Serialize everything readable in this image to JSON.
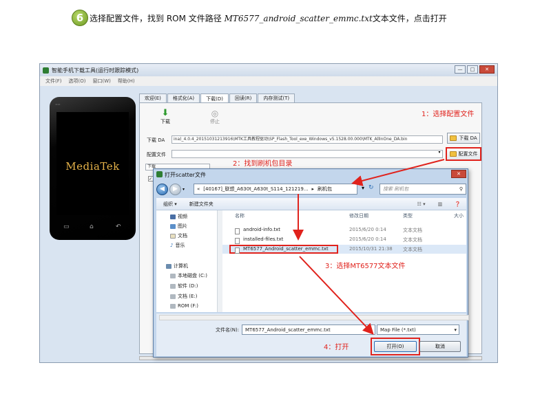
{
  "step": {
    "number": "6",
    "text_prefix": "选择配置文件，找到 ROM 文件路径 ",
    "text_italic": "MT6577_android_scatter_emmc.txt",
    "text_suffix": "文本文件，点击打开"
  },
  "app_window": {
    "title": "智能手机下载工具(运行时跟踪模式)",
    "menu": [
      "文件(F)",
      "选项(O)",
      "窗口(W)",
      "帮助(H)"
    ],
    "phone_brand": "MediaTek",
    "tabs": [
      "欢迎(E)",
      "格式化(A)",
      "下载(D)",
      "回读(R)",
      "内存测试(T)"
    ],
    "active_tab": "下载(D)",
    "download_label": "下载",
    "stop_label": "停止",
    "da_label": "下载 DA",
    "da_path": "ina)_4.0.4_20151031213916\\MTK工具教程驱动\\SP_Flash_Tool_exe_Windows_v5.1528.00.000\\MTK_AllInOne_DA.bin",
    "da_button": "下载 DA",
    "scatter_label": "配置文件",
    "scatter_button": "配置文件",
    "mode_select": "下载"
  },
  "annotations": {
    "a1": "1：选择配置文件",
    "a2": "2：找到刷机包目录",
    "a3": "3：选择MT6577文本文件",
    "a4": "4：打开"
  },
  "dialog": {
    "title": "打开scatter文件",
    "address_parts": [
      "«",
      "[40167]_联想_A630t_A630t_S114_121219...",
      "▸",
      "刷机包"
    ],
    "search_placeholder": "搜索 刷机包",
    "organize": "组织 ▾",
    "new_folder": "新建文件夹",
    "nav_items": [
      "视频",
      "图片",
      "文档",
      "音乐",
      "计算机",
      "本地磁盘 (C:)",
      "软件 (D:)",
      "文档 (E:)",
      "ROM (F:)"
    ],
    "columns": [
      "名称",
      "修改日期",
      "类型",
      "大小"
    ],
    "files": [
      {
        "name": "android-info.txt",
        "date": "2015/6/20 0:14",
        "type": "文本文档"
      },
      {
        "name": "installed-files.txt",
        "date": "2015/6/20 0:14",
        "type": "文本文档"
      },
      {
        "name": "MT6577_Android_scatter_emmc.txt",
        "date": "2015/10/31 21:38",
        "type": "文本文档"
      }
    ],
    "filename_label": "文件名(N):",
    "filename_value": "MT6577_Android_scatter_emmc.txt",
    "filter_value": "Map File (*.txt)",
    "open_button": "打开(O)",
    "cancel_button": "取消"
  },
  "colors": {
    "annotation_red": "#e0221c",
    "step_green": "#6e9a22"
  }
}
